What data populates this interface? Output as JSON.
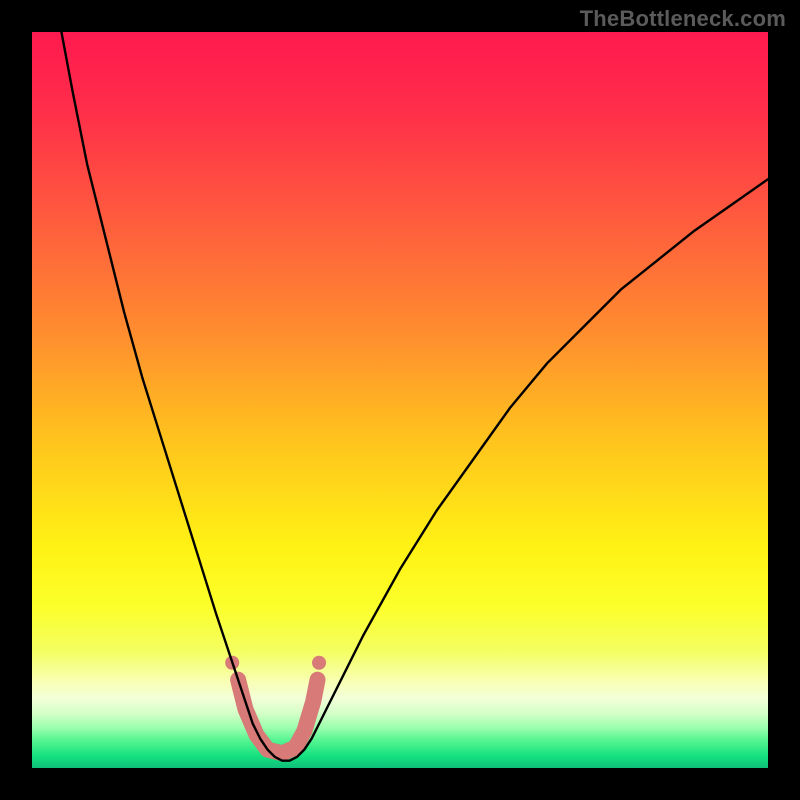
{
  "watermark": {
    "text": "TheBottleneck.com"
  },
  "chart_data": {
    "type": "line",
    "title": "",
    "xlabel": "",
    "ylabel": "",
    "xlim": [
      0,
      100
    ],
    "ylim": [
      0,
      100
    ],
    "series": [
      {
        "name": "curve",
        "x": [
          4,
          5.5,
          7.5,
          10,
          12.5,
          15,
          17.5,
          20,
          22.5,
          25,
          26,
          27,
          28,
          29,
          30,
          31,
          32,
          33,
          34,
          35,
          36,
          37,
          38,
          40,
          42.5,
          45,
          50,
          55,
          60,
          65,
          70,
          75,
          80,
          85,
          90,
          95,
          100
        ],
        "y": [
          100,
          92,
          82,
          72,
          62,
          53,
          45,
          37,
          29,
          21,
          18,
          15,
          12,
          9,
          6,
          4,
          2.5,
          1.5,
          1,
          1,
          1.5,
          2.5,
          4,
          8,
          13,
          18,
          27,
          35,
          42,
          49,
          55,
          60,
          65,
          69,
          73,
          76.5,
          80
        ],
        "stroke": "#000000",
        "stroke_width": 2.4
      }
    ],
    "valley_markers": {
      "color": "#d77a78",
      "dots": [
        {
          "x": 27.2,
          "y": 14.3,
          "r": 7
        },
        {
          "x": 39.0,
          "y": 14.3,
          "r": 7
        }
      ],
      "thick_path": {
        "stroke_width": 16,
        "points": [
          {
            "x": 28.0,
            "y": 12.0
          },
          {
            "x": 29.0,
            "y": 8.0
          },
          {
            "x": 30.5,
            "y": 4.5
          },
          {
            "x": 32.0,
            "y": 2.5
          },
          {
            "x": 34.0,
            "y": 2.0
          },
          {
            "x": 35.8,
            "y": 2.8
          },
          {
            "x": 37.0,
            "y": 5.0
          },
          {
            "x": 38.2,
            "y": 9.0
          },
          {
            "x": 38.8,
            "y": 12.0
          }
        ]
      }
    },
    "background_gradient": {
      "stops": [
        {
          "pos": 0.0,
          "color": "#ff1a4f"
        },
        {
          "pos": 0.1,
          "color": "#ff2c4a"
        },
        {
          "pos": 0.25,
          "color": "#ff5a3e"
        },
        {
          "pos": 0.4,
          "color": "#ff8a30"
        },
        {
          "pos": 0.55,
          "color": "#ffc21e"
        },
        {
          "pos": 0.7,
          "color": "#fff214"
        },
        {
          "pos": 0.78,
          "color": "#fcff2a"
        },
        {
          "pos": 0.84,
          "color": "#f4ff60"
        },
        {
          "pos": 0.885,
          "color": "#f8ffb8"
        },
        {
          "pos": 0.905,
          "color": "#f3ffd8"
        },
        {
          "pos": 0.925,
          "color": "#d6ffc8"
        },
        {
          "pos": 0.945,
          "color": "#9cffae"
        },
        {
          "pos": 0.965,
          "color": "#4cf38e"
        },
        {
          "pos": 0.985,
          "color": "#13df7f"
        },
        {
          "pos": 1.0,
          "color": "#0fbf79"
        }
      ]
    }
  }
}
